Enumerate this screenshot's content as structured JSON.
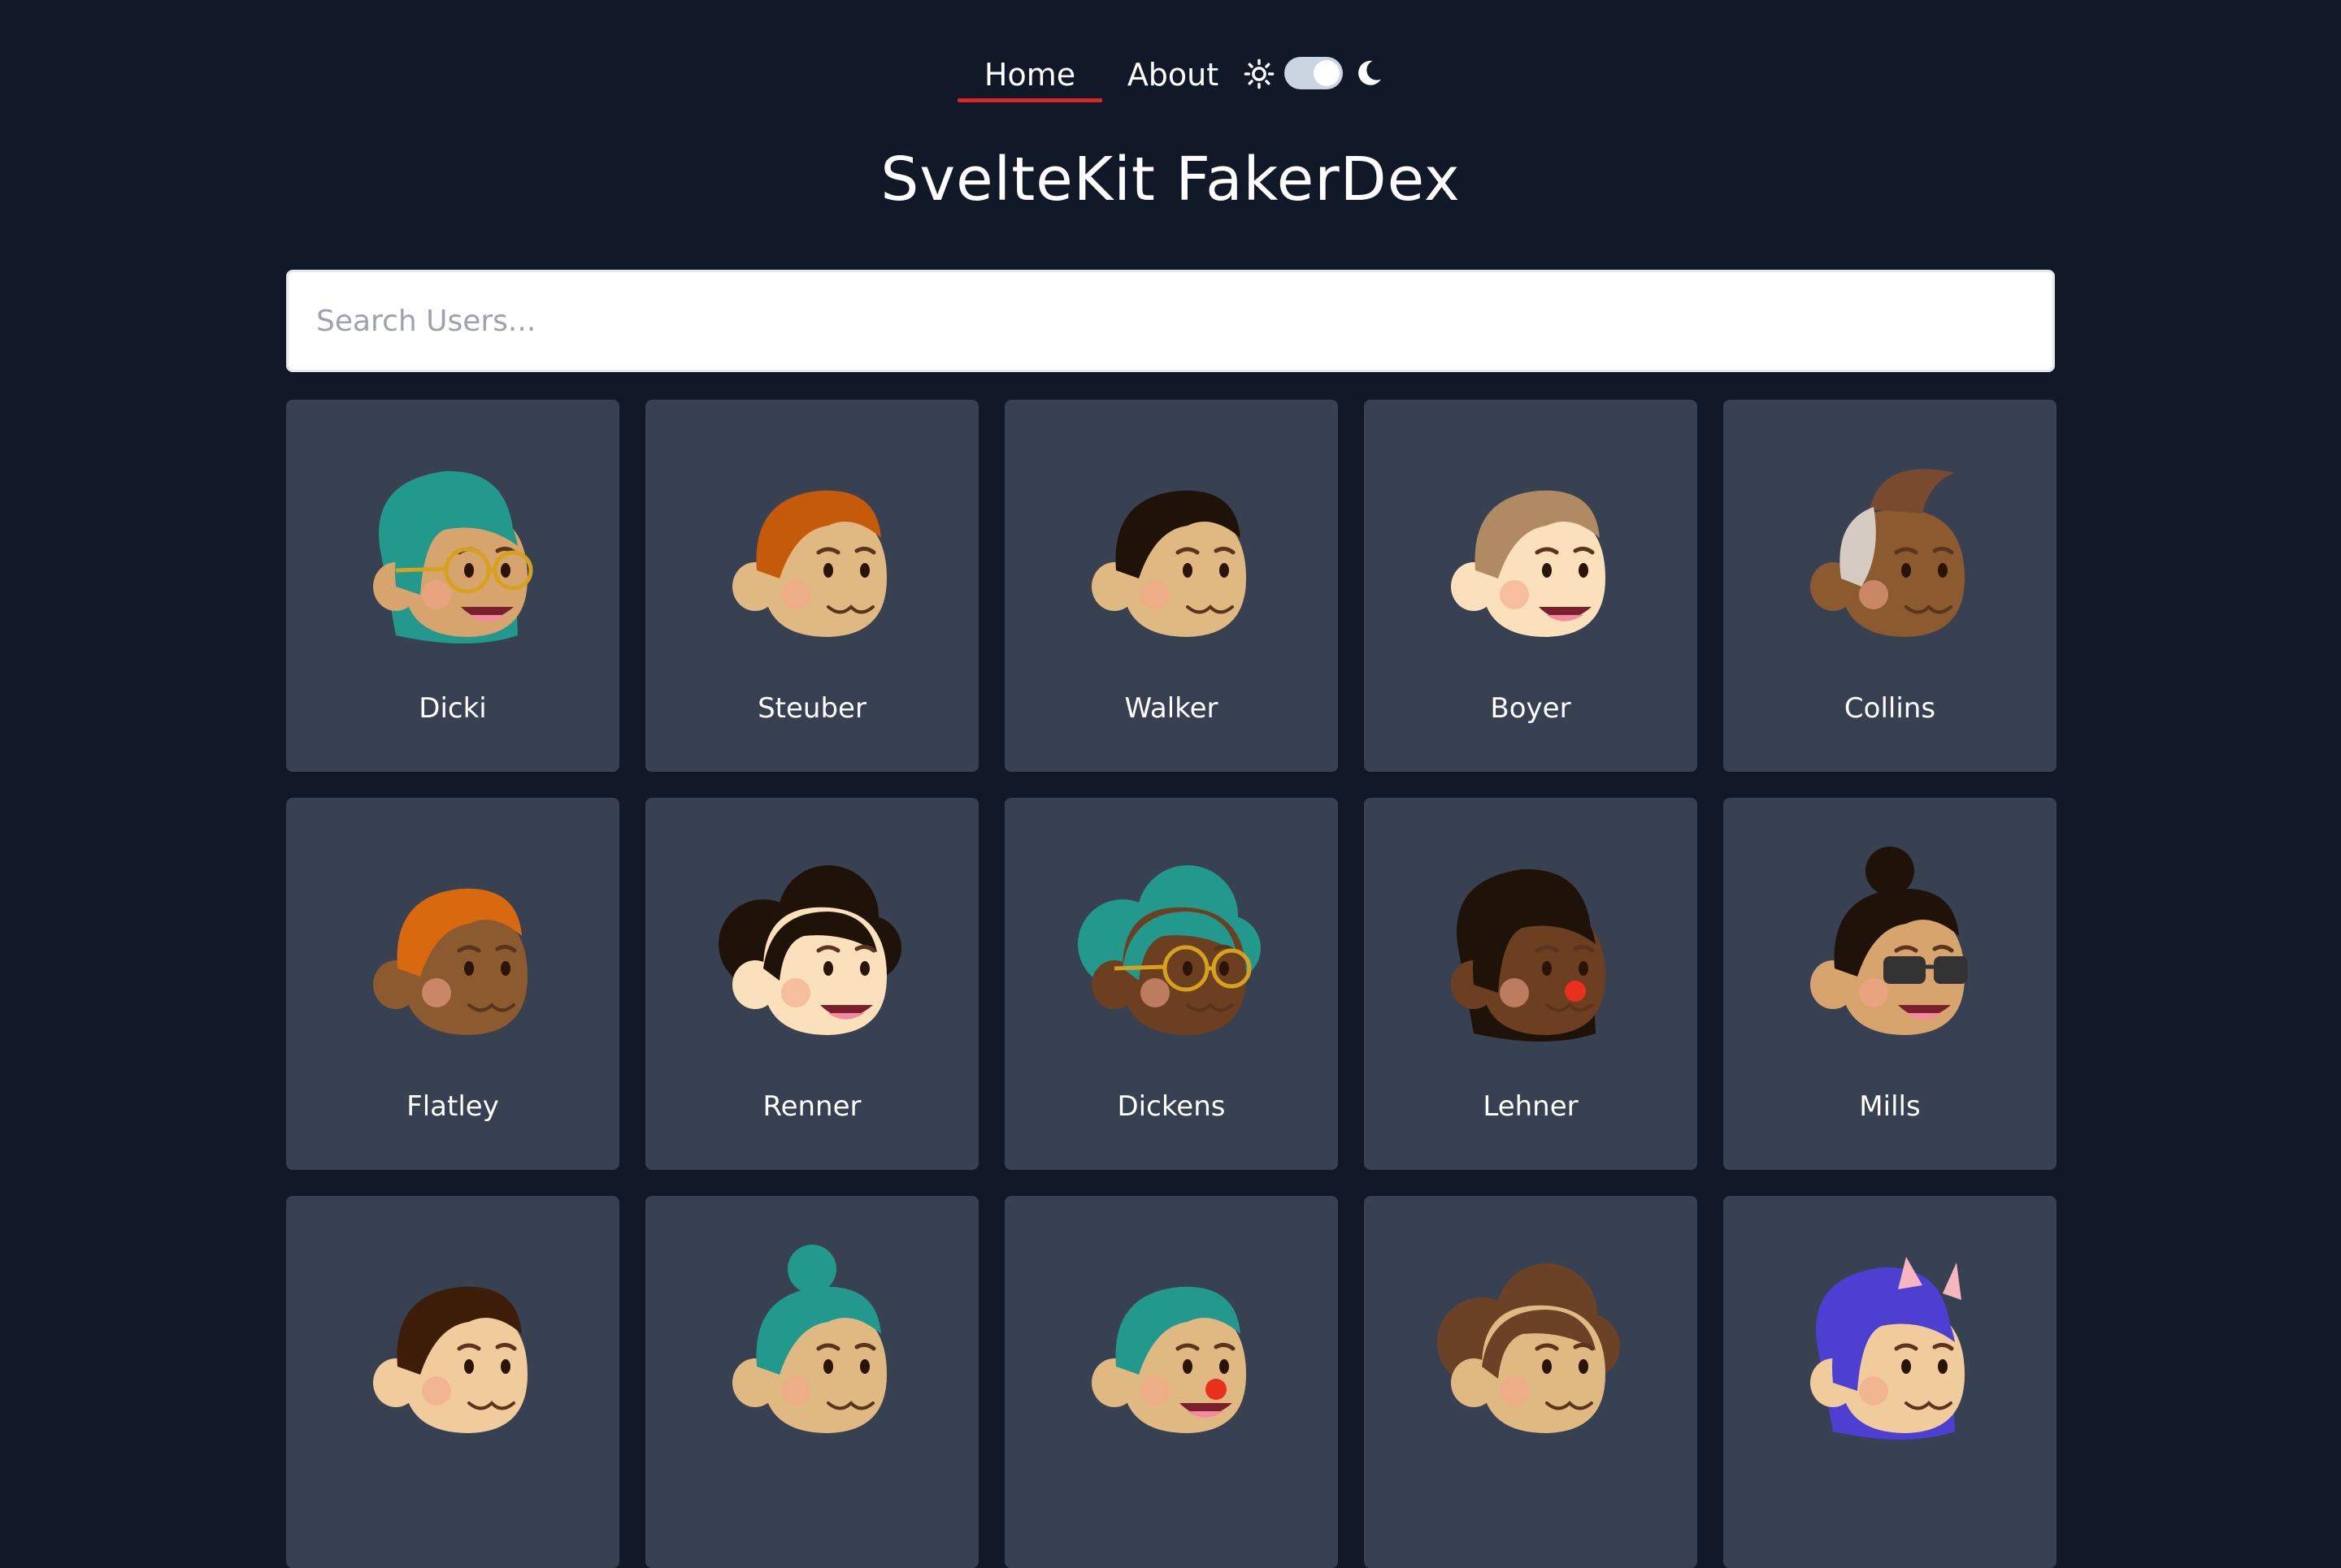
{
  "nav": {
    "home_label": "Home",
    "about_label": "About",
    "theme": {
      "sun_icon": "sun-icon",
      "moon_icon": "moon-icon",
      "dark_mode": true
    }
  },
  "title": "SvelteKit FakerDex",
  "search": {
    "placeholder": "Search Users...",
    "value": ""
  },
  "colors": {
    "background": "#111827",
    "card": "#374151",
    "accent": "#dc2626",
    "text": "#ffffff"
  },
  "users": [
    {
      "name": "Dicki",
      "skin": "#d6a46c",
      "hair": "#23998e",
      "hair_style": "long",
      "accessory": "glasses"
    },
    {
      "name": "Steuber",
      "skin": "#e0b882",
      "hair": "#c65a0b",
      "hair_style": "wavy",
      "accessory": "none"
    },
    {
      "name": "Walker",
      "skin": "#e0b882",
      "hair": "#1f1209",
      "hair_style": "short",
      "accessory": "none"
    },
    {
      "name": "Boyer",
      "skin": "#fbe0bc",
      "hair": "#b08a62",
      "hair_style": "short",
      "accessory": "none"
    },
    {
      "name": "Collins",
      "skin": "#8b5a2e",
      "hair": "#d6cbc2",
      "hair_style": "mohawk",
      "accessory": "none"
    },
    {
      "name": "Flatley",
      "skin": "#8b5a2e",
      "hair": "#d9690e",
      "hair_style": "short",
      "accessory": "none"
    },
    {
      "name": "Renner",
      "skin": "#fbe0bc",
      "hair": "#1f1209",
      "hair_style": "curly",
      "accessory": "none"
    },
    {
      "name": "Dickens",
      "skin": "#6b3f1f",
      "hair": "#23998e",
      "hair_style": "curly",
      "accessory": "glasses"
    },
    {
      "name": "Lehner",
      "skin": "#6b3f1f",
      "hair": "#1f1209",
      "hair_style": "long",
      "accessory": "clown-nose"
    },
    {
      "name": "Mills",
      "skin": "#d6a46c",
      "hair": "#1f1209",
      "hair_style": "bun",
      "accessory": "sunglasses"
    },
    {
      "name": "",
      "skin": "#f0cc9c",
      "hair": "#3d1d08",
      "hair_style": "short",
      "accessory": "none"
    },
    {
      "name": "",
      "skin": "#e0b882",
      "hair": "#23998e",
      "hair_style": "bun",
      "accessory": "none"
    },
    {
      "name": "",
      "skin": "#e0b882",
      "hair": "#23998e",
      "hair_style": "short",
      "accessory": "clown-nose"
    },
    {
      "name": "",
      "skin": "#e0b882",
      "hair": "#6b4226",
      "hair_style": "curly",
      "accessory": "none"
    },
    {
      "name": "",
      "skin": "#f0cc9c",
      "hair": "#4c3fd1",
      "hair_style": "braids",
      "accessory": "cat-ears"
    }
  ]
}
